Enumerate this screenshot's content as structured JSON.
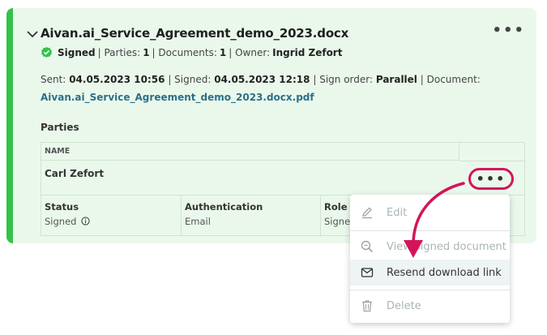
{
  "card": {
    "title": "Aivan.ai_Service_Agreement_demo_2023.docx",
    "status": "Signed",
    "parties_label": "| Parties:",
    "parties_count": "1",
    "documents_label": "| Documents:",
    "documents_count": "1",
    "owner_label": "| Owner:",
    "owner": "Ingrid Zefort",
    "sent_label": "Sent:",
    "sent": "04.05.2023 10:56",
    "signed_label": "| Signed:",
    "signed": "04.05.2023 12:18",
    "sign_order_label": "| Sign order:",
    "sign_order": "Parallel",
    "document_label": "| Document:",
    "document_link": "Aivan.ai_Service_Agreement_demo_2023.docx.pdf"
  },
  "parties": {
    "heading": "Parties",
    "name_header": "NAME",
    "name": "Carl Zefort",
    "status_label": "Status",
    "status_value": "Signed",
    "auth_label": "Authentication",
    "auth_value": "Email",
    "role_label": "Role",
    "role_value": "Signer"
  },
  "menu": {
    "items": [
      {
        "label": "Edit",
        "icon": "pencil-icon",
        "enabled": false
      },
      {
        "label": "View signed document",
        "icon": "zoom-icon",
        "enabled": false
      },
      {
        "label": "Resend download link",
        "icon": "envelope-icon",
        "enabled": true
      },
      {
        "label": "Delete",
        "icon": "trash-icon",
        "enabled": false
      }
    ]
  },
  "colors": {
    "card_bg": "#eaf8ec",
    "accent_green": "#34c24a",
    "highlight": "#d3145a",
    "link": "#2d6f87"
  }
}
